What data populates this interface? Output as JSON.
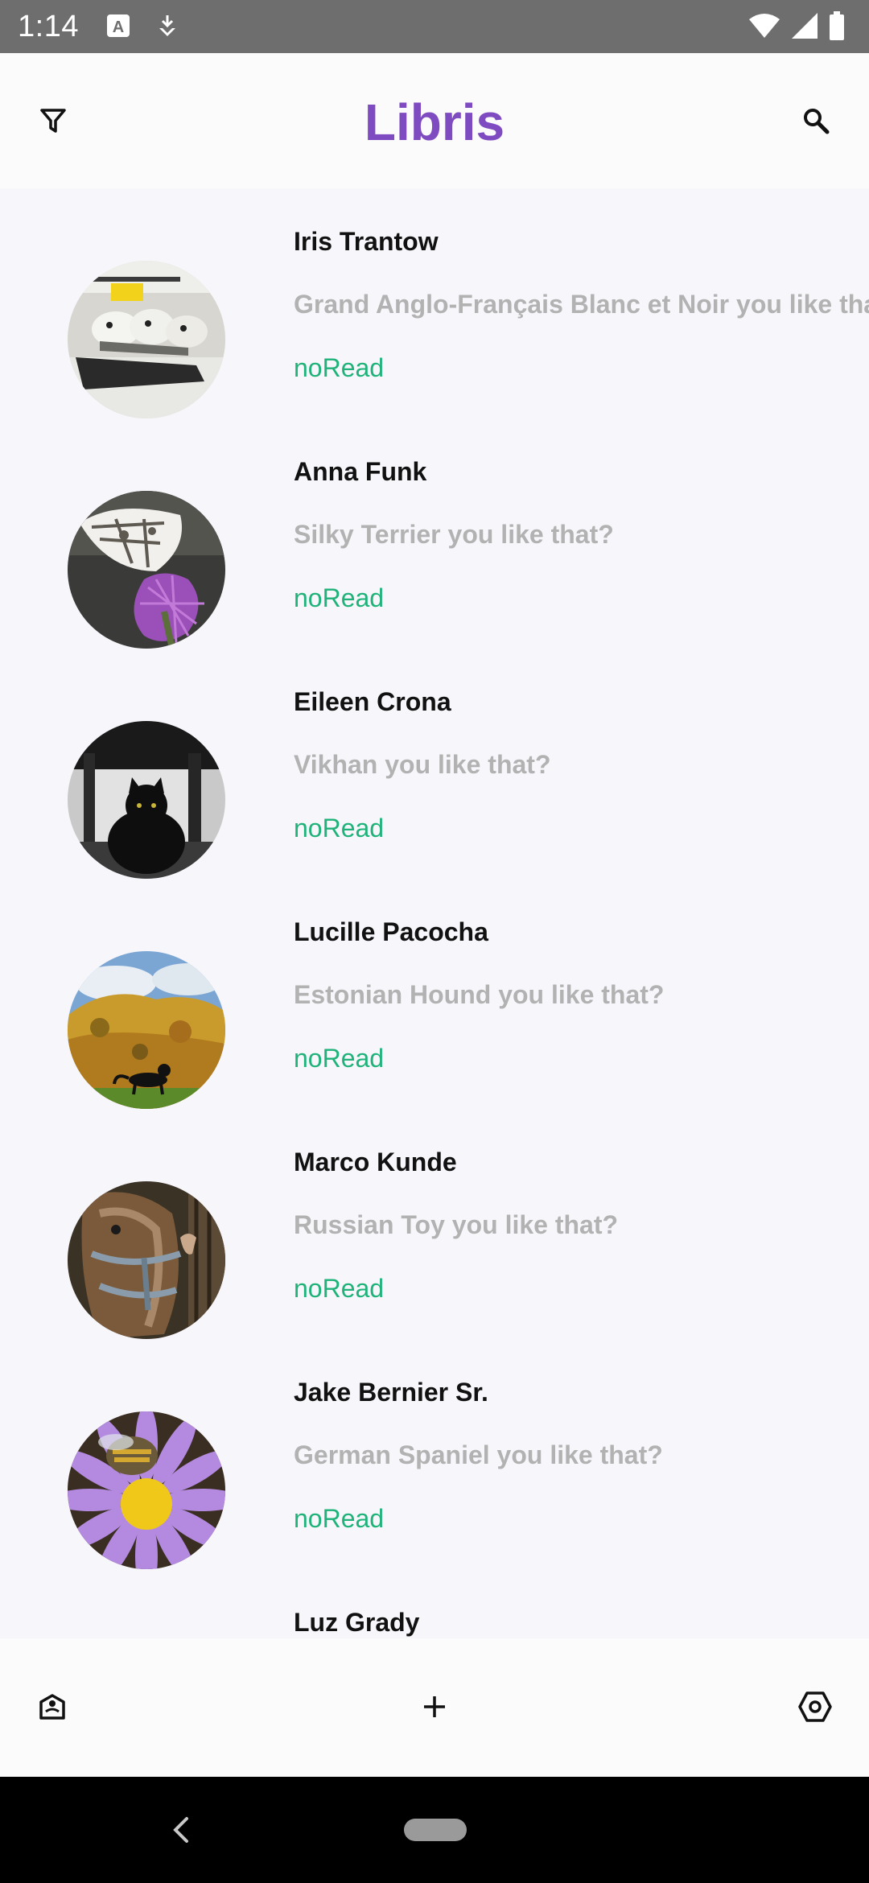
{
  "status_bar": {
    "time": "1:14",
    "icons": [
      "keyboard-a-icon",
      "download-icon",
      "wifi-icon",
      "signal-icon",
      "battery-icon"
    ]
  },
  "top_bar": {
    "title": "Libris",
    "title_color": "#7e4bc1",
    "left_icon": "filter-icon",
    "right_icon": "search-icon"
  },
  "conversations": [
    {
      "name": "Iris Trantow",
      "message": "Grand Anglo-Français Blanc et Noir you like that?",
      "status": "noRead",
      "avatar": "figurines-photo"
    },
    {
      "name": "Anna Funk",
      "message": "Silky Terrier you like that?",
      "status": "noRead",
      "avatar": "butterfly-photo"
    },
    {
      "name": "Eileen Crona",
      "message": "Vikhan you like that?",
      "status": "noRead",
      "avatar": "black-cat-photo"
    },
    {
      "name": "Lucille Pacocha",
      "message": "Estonian Hound you like that?",
      "status": "noRead",
      "avatar": "autumn-cat-photo"
    },
    {
      "name": "Marco Kunde",
      "message": "Russian Toy you like that?",
      "status": "noRead",
      "avatar": "horse-photo"
    },
    {
      "name": "Jake Bernier Sr.",
      "message": "German Spaniel you like that?",
      "status": "noRead",
      "avatar": "bee-flower-photo"
    },
    {
      "name": "Luz Grady",
      "message": "",
      "status": "",
      "avatar": ""
    }
  ],
  "bottom_bar": {
    "left_icon": "contacts-icon",
    "center_icon": "add-icon",
    "right_icon": "settings-icon"
  },
  "colors": {
    "status_read": "#1fb37a",
    "message_gray": "#b2b2b2",
    "background": "#f7f6fb"
  }
}
